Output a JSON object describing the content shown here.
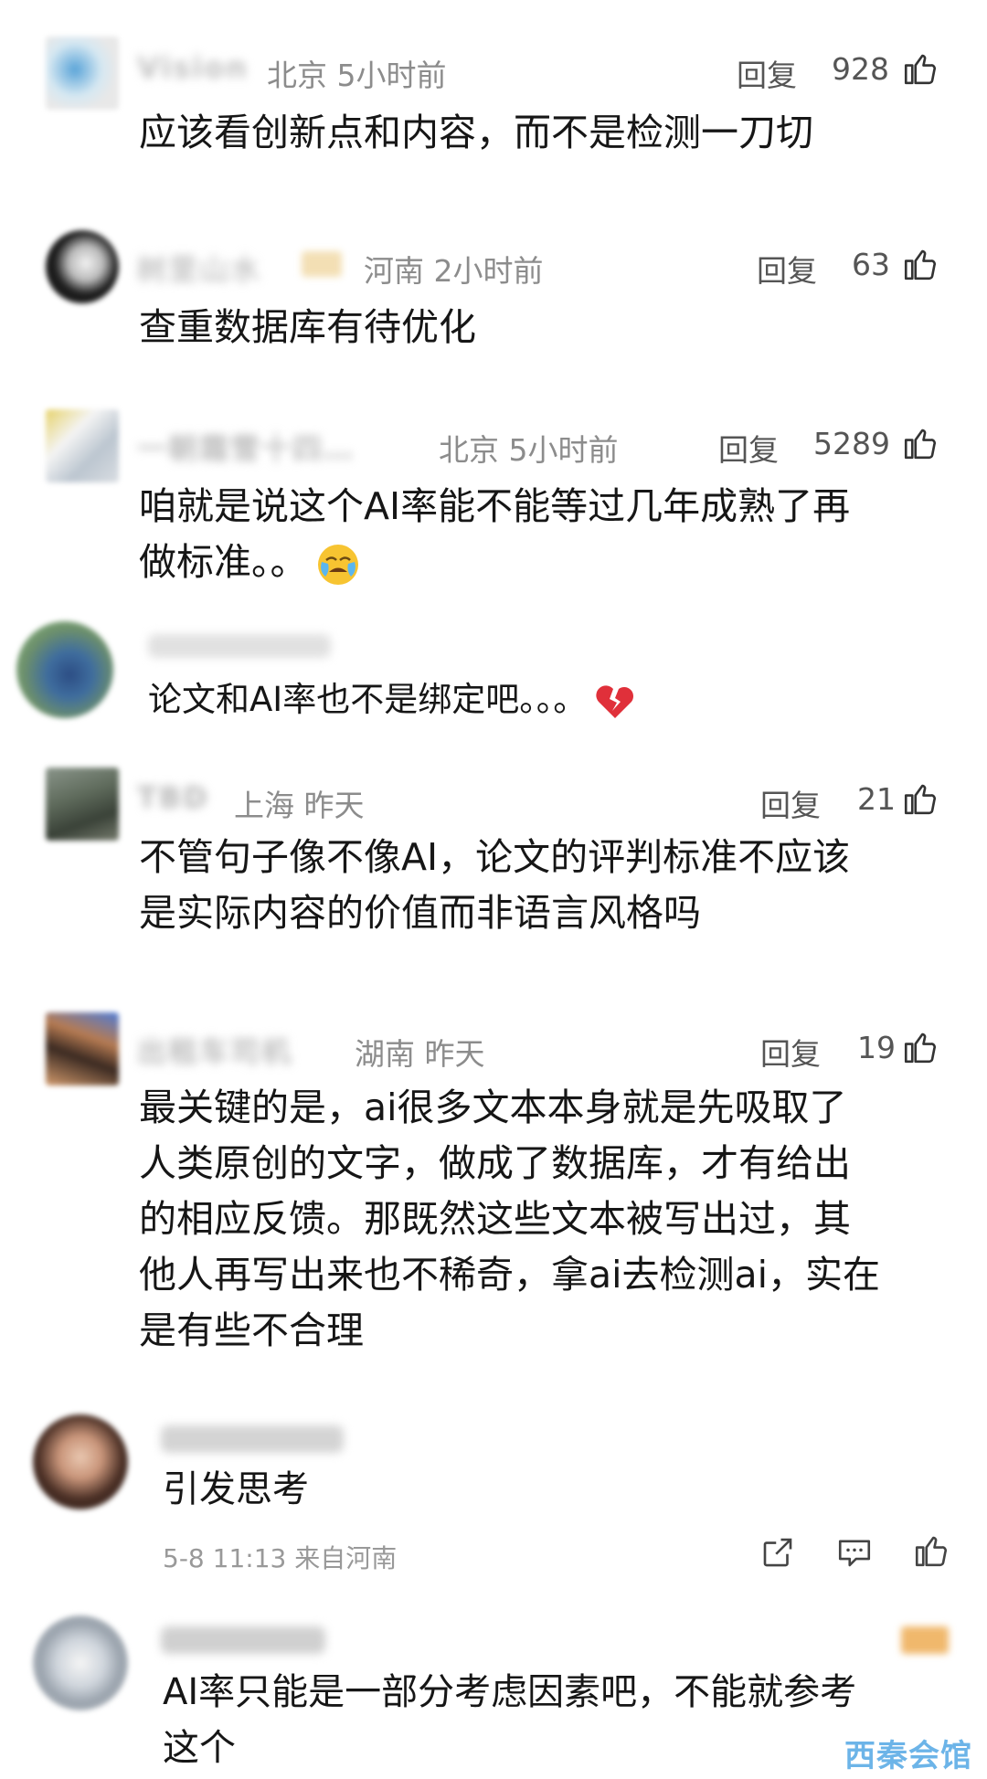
{
  "reply_label": "回复",
  "comments": [
    {
      "user": "Vision",
      "location": "北京",
      "time": "5小时前",
      "likes": "928",
      "lines": [
        "应该看创新点和内容，而不是检测一刀切"
      ]
    },
    {
      "user": "树里山水",
      "location": "河南",
      "time": "2小时前",
      "likes": "63",
      "lines": [
        "查重数据库有待优化"
      ]
    },
    {
      "user": "一朝霜雪十四…",
      "location": "北京",
      "time": "5小时前",
      "likes": "5289",
      "lines": [
        "咱就是说这个AI率能不能等过几年成熟了再",
        "做标准。。"
      ]
    },
    {
      "user": "",
      "location": "",
      "time": "",
      "likes": "",
      "lines": [
        "论文和AI率也不是绑定吧。。。"
      ]
    },
    {
      "user": "TBD",
      "location": "上海",
      "time": "昨天",
      "likes": "21",
      "lines": [
        "不管句子像不像AI，论文的评判标准不应该",
        "是实际内容的价值而非语言风格吗"
      ]
    },
    {
      "user": "出租车司机",
      "location": "湖南",
      "time": "昨天",
      "likes": "19",
      "lines": [
        "最关键的是，ai很多文本本身就是先吸取了",
        "人类原创的文字，做成了数据库，才有给出",
        "的相应反馈。那既然这些文本被写出过，其",
        "他人再写出来也不稀奇，拿ai去检测ai，实在",
        "是有些不合理"
      ]
    },
    {
      "user": "",
      "location": "",
      "time": "",
      "likes": "",
      "lines": [
        "引发思考"
      ],
      "footer": "5-8 11:13 来自河南"
    },
    {
      "user": "",
      "location": "",
      "time": "",
      "likes": "",
      "lines": [
        "AI率只能是一部分考虑因素吧，不能就参考",
        "这个"
      ]
    }
  ],
  "watermark": "西秦会馆",
  "icons": {
    "like": "thumbs-up-icon",
    "share": "share-icon",
    "comment": "comment-icon",
    "cry": "crying-emoji",
    "heartbreak": "broken-heart-emoji"
  }
}
